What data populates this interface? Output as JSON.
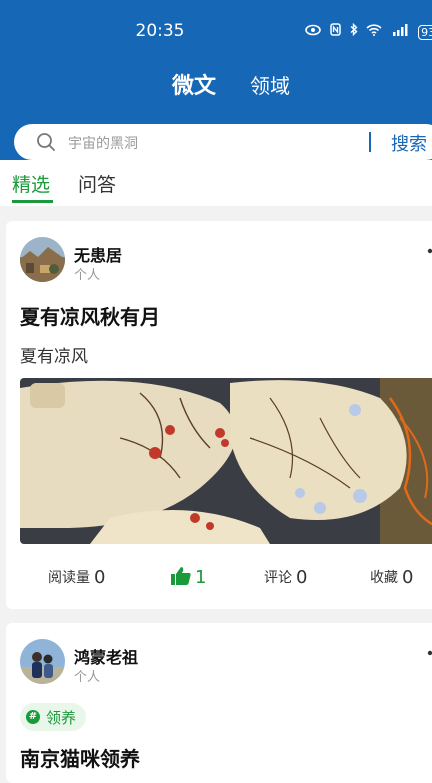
{
  "status_bar": {
    "time": "20:35",
    "battery": "93"
  },
  "top_tabs": {
    "active": "微文",
    "other": "领域"
  },
  "search": {
    "placeholder": "宇宙的黑洞",
    "button_label": "搜索"
  },
  "sub_tabs": {
    "active": "精选",
    "other": "问答"
  },
  "colors": {
    "brand_blue": "#1767b7",
    "accent_green": "#1a9a3a"
  },
  "posts": [
    {
      "author": "无患居",
      "author_type": "个人",
      "title": "夏有凉风秋有月",
      "description": "夏有凉风",
      "image": "painted-fans-photo",
      "stats": {
        "read_label": "阅读量",
        "read_count": "0",
        "like_count": "1",
        "comment_label": "评论",
        "comment_count": "0",
        "favorite_label": "收藏",
        "favorite_count": "0"
      }
    },
    {
      "author": "鸿蒙老祖",
      "author_type": "个人",
      "topic": "领养",
      "title": "南京猫咪领养"
    }
  ]
}
